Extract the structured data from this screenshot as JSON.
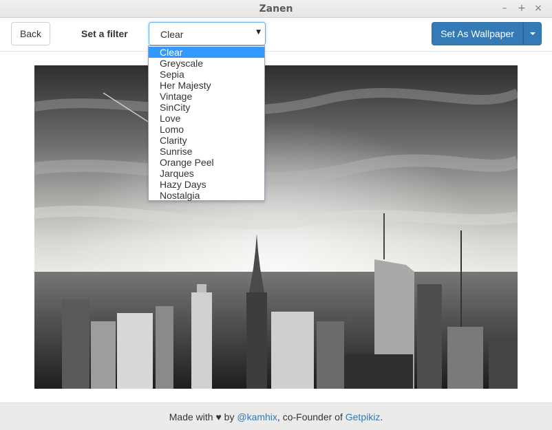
{
  "window": {
    "title": "Zanen",
    "minimize_glyph": "–",
    "maximize_glyph": "+",
    "close_glyph": "×"
  },
  "toolbar": {
    "back_label": "Back",
    "filter_label": "Set a filter",
    "filter_value": "Clear",
    "wallpaper_label": "Set As Wallpaper"
  },
  "dropdown": {
    "options": [
      "Clear",
      "Greyscale",
      "Sepia",
      "Her Majesty",
      "Vintage",
      "SinCity",
      "Love",
      "Lomo",
      "Clarity",
      "Sunrise",
      "Orange Peel",
      "Jarques",
      "Hazy Days",
      "Nostalgia"
    ],
    "selected": "Clear"
  },
  "footer": {
    "made_with": "Made with",
    "heart": "♥",
    "by": "by",
    "author": "@kamhix",
    "cofounder": ", co-Founder of",
    "company": "Getpikiz",
    "period": "."
  },
  "colors": {
    "accent": "#337ab7",
    "selection": "#3399ff",
    "footer_bg": "#ebebe9"
  },
  "icons": {
    "select_arrow": "triangle-down-icon",
    "split_caret": "caret-down-icon"
  }
}
